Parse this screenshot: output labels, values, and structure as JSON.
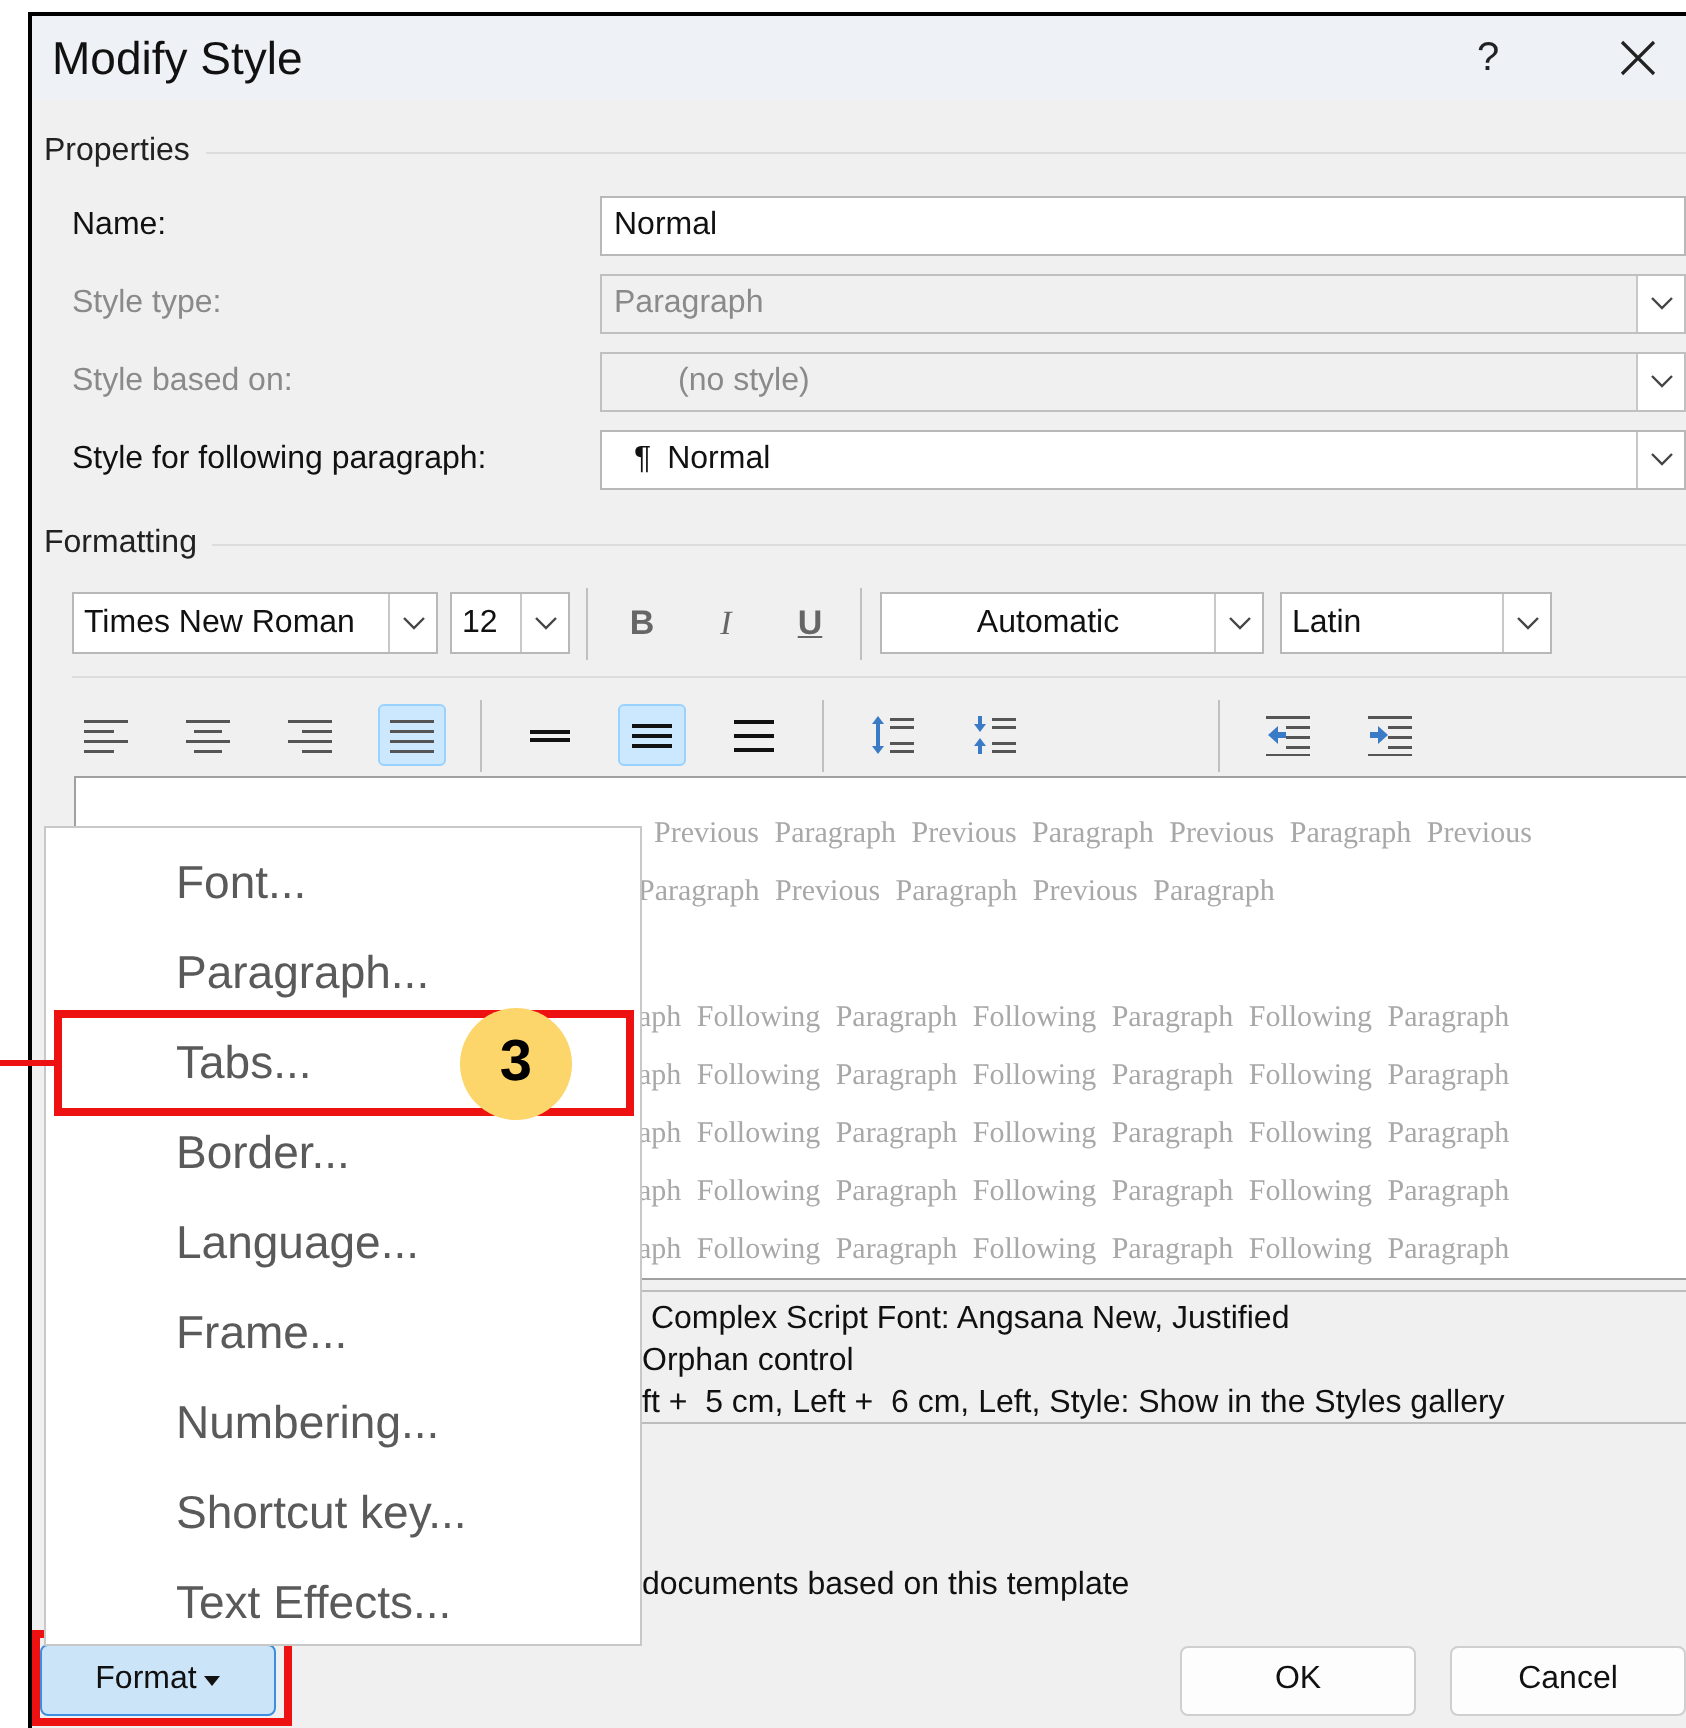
{
  "window": {
    "title": "Modify Style",
    "help": "?"
  },
  "properties": {
    "heading": "Properties",
    "fields": [
      {
        "label": "Name:",
        "kind": "text",
        "value": "Normal",
        "disabled": false
      },
      {
        "label": "Style type:",
        "kind": "dropdown",
        "value": "Paragraph",
        "disabled": true
      },
      {
        "label": "Style based on:",
        "kind": "dropdown",
        "value": "(no style)",
        "disabled": true
      },
      {
        "label": "Style for following paragraph:",
        "kind": "dropdown",
        "prefix": "¶",
        "value": "Normal",
        "disabled": false
      }
    ]
  },
  "formatting": {
    "heading": "Formatting",
    "font": "Times New Roman",
    "size": "12",
    "style_buttons": [
      {
        "label": "B",
        "kind": "bold"
      },
      {
        "label": "I",
        "kind": "italic"
      },
      {
        "label": "U",
        "kind": "underline"
      }
    ],
    "font_color_setting": "Automatic",
    "script": "Latin",
    "paragraph_groups": [
      [
        {
          "kind": "align_left",
          "selected": false
        },
        {
          "kind": "align_center",
          "selected": false
        },
        {
          "kind": "align_right",
          "selected": false
        },
        {
          "kind": "justify",
          "selected": true
        }
      ],
      [
        {
          "kind": "single_spacing",
          "selected": false
        },
        {
          "kind": "one_half_spacing",
          "selected": true
        },
        {
          "kind": "double_spacing",
          "selected": false
        }
      ],
      [
        {
          "kind": "increase_spacing",
          "selected": false
        },
        {
          "kind": "decrease_spacing",
          "selected": false
        }
      ],
      [
        {
          "kind": "decrease_indent",
          "selected": false
        },
        {
          "kind": "increase_indent",
          "selected": false
        }
      ]
    ]
  },
  "preview": {
    "previous_lines": [
      "Previous Paragraph Previous Paragraph Previous Paragraph Previous",
      "Paragraph Previous Paragraph Previous Paragraph"
    ],
    "following_lines": [
      "aph Following Paragraph Following Paragraph Following Paragraph",
      "aph Following Paragraph Following Paragraph Following Paragraph",
      "aph Following Paragraph Following Paragraph Following Paragraph",
      "aph Following Paragraph Following Paragraph Following Paragraph",
      "aph Following Paragraph Following Paragraph Following Paragraph"
    ]
  },
  "description": [
    " Complex Script Font: Angsana New, Justified",
    "Orphan control",
    "ft +  5 cm, Left +  6 cm, Left, Style: Show in the Styles gallery"
  ],
  "template_option": "documents based on this template",
  "format_menu": [
    {
      "label": "Font...",
      "highlighted": false
    },
    {
      "label": "Paragraph...",
      "highlighted": false
    },
    {
      "label": "Tabs...",
      "highlighted": true,
      "callout": "3"
    },
    {
      "label": "Border...",
      "highlighted": false
    },
    {
      "label": "Language...",
      "highlighted": false
    },
    {
      "label": "Frame...",
      "highlighted": false
    },
    {
      "label": "Numbering...",
      "highlighted": false
    },
    {
      "label": "Shortcut key...",
      "highlighted": false
    },
    {
      "label": "Text Effects...",
      "highlighted": false
    }
  ],
  "format_button": {
    "label": "Format",
    "highlighted": true
  },
  "buttons": [
    "OK",
    "Cancel"
  ]
}
